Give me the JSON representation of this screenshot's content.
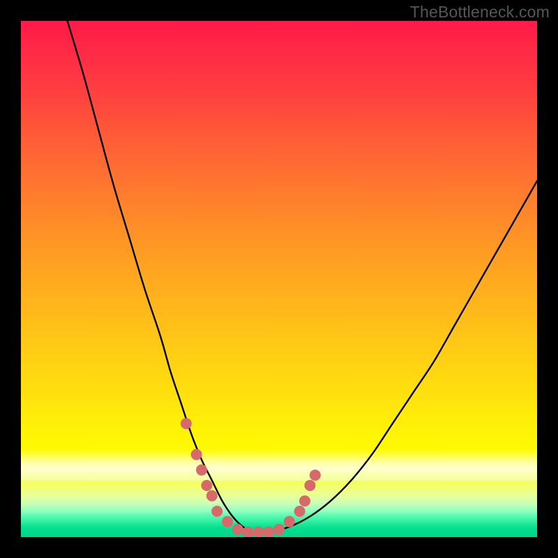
{
  "watermark": "TheBottleneck.com",
  "chart_data": {
    "type": "line",
    "title": "",
    "xlabel": "",
    "ylabel": "",
    "xlim": [
      0,
      100
    ],
    "ylim": [
      0,
      100
    ],
    "grid": false,
    "legend": false,
    "series": [
      {
        "name": "bottleneck-curve",
        "color": "#000000",
        "x": [
          9,
          12,
          15,
          18,
          21,
          24,
          27,
          29,
          31,
          33,
          35,
          37,
          39,
          41,
          43,
          45,
          48,
          52,
          56,
          60,
          64,
          68,
          72,
          76,
          80,
          84,
          88,
          92,
          96,
          100
        ],
        "y": [
          100,
          90,
          79,
          68,
          58,
          48,
          39,
          32,
          26,
          20,
          15,
          11,
          7,
          4,
          2,
          1,
          1,
          2,
          4,
          7,
          11,
          16,
          22,
          28,
          34,
          41,
          48,
          55,
          62,
          69
        ]
      }
    ],
    "markers": {
      "name": "highlight-points",
      "color": "#d66a6a",
      "radius_px": 8,
      "points": [
        {
          "x": 32,
          "y": 22
        },
        {
          "x": 34,
          "y": 16
        },
        {
          "x": 35,
          "y": 13
        },
        {
          "x": 36,
          "y": 10
        },
        {
          "x": 37,
          "y": 8
        },
        {
          "x": 38,
          "y": 5
        },
        {
          "x": 40,
          "y": 3
        },
        {
          "x": 42,
          "y": 1.5
        },
        {
          "x": 44,
          "y": 1
        },
        {
          "x": 46,
          "y": 1
        },
        {
          "x": 48,
          "y": 1
        },
        {
          "x": 50,
          "y": 1.5
        },
        {
          "x": 52,
          "y": 3
        },
        {
          "x": 54,
          "y": 5
        },
        {
          "x": 55,
          "y": 7
        },
        {
          "x": 56,
          "y": 10
        },
        {
          "x": 57,
          "y": 12
        }
      ]
    },
    "background": {
      "type": "vertical-gradient",
      "stops": [
        {
          "pos": 0.0,
          "color": "#ff1a47"
        },
        {
          "pos": 0.5,
          "color": "#ffae1e"
        },
        {
          "pos": 0.85,
          "color": "#fffb02"
        },
        {
          "pos": 1.0,
          "color": "#00d68c"
        }
      ]
    }
  }
}
